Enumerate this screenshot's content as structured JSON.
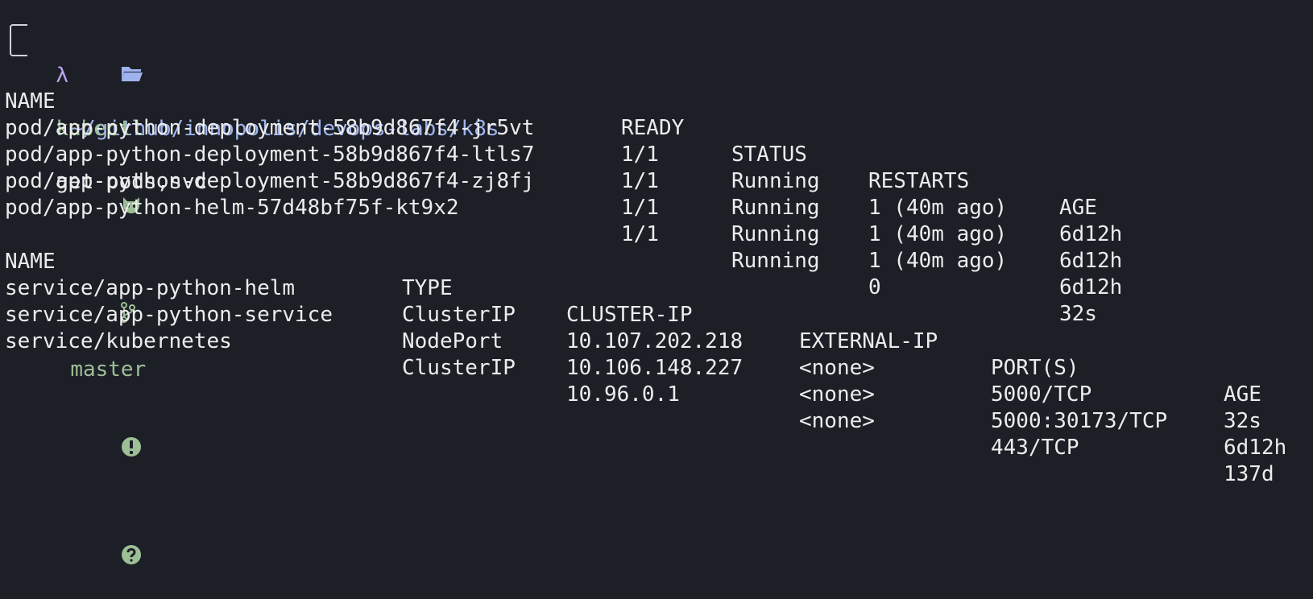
{
  "prompt": {
    "path": "~/github/innopolis/devops-labs/k8s",
    "branch": "master",
    "lambda": "λ",
    "command_bin": "kubectl",
    "command_args": "get pods,svc",
    "icons": [
      "folder-icon",
      "github-cat-icon",
      "git-branch-icon",
      "exclamation-icon",
      "question-icon"
    ]
  },
  "pods": {
    "headers": [
      "NAME",
      "READY",
      "STATUS",
      "RESTARTS",
      "AGE"
    ],
    "rows": [
      [
        "pod/app-python-deployment-58b9d867f4-jr5vt",
        "1/1",
        "Running",
        "1 (40m ago)",
        "6d12h"
      ],
      [
        "pod/app-python-deployment-58b9d867f4-ltls7",
        "1/1",
        "Running",
        "1 (40m ago)",
        "6d12h"
      ],
      [
        "pod/app-python-deployment-58b9d867f4-zj8fj",
        "1/1",
        "Running",
        "1 (40m ago)",
        "6d12h"
      ],
      [
        "pod/app-python-helm-57d48bf75f-kt9x2",
        "1/1",
        "Running",
        "0",
        "32s"
      ]
    ]
  },
  "services": {
    "headers": [
      "NAME",
      "TYPE",
      "CLUSTER-IP",
      "EXTERNAL-IP",
      "PORT(S)",
      "AGE"
    ],
    "rows": [
      [
        "service/app-python-helm",
        "ClusterIP",
        "10.107.202.218",
        "<none>",
        "5000/TCP",
        "32s"
      ],
      [
        "service/app-python-service",
        "NodePort",
        "10.106.148.227",
        "<none>",
        "5000:30173/TCP",
        "6d12h"
      ],
      [
        "service/kubernetes",
        "ClusterIP",
        "10.96.0.1",
        "<none>",
        "443/TCP",
        "137d"
      ]
    ]
  },
  "colors": {
    "background": "#1d1f27",
    "path": "#9fb4ee",
    "git": "#9dbf96",
    "lambda": "#bda6ef",
    "text": "#ececec"
  }
}
